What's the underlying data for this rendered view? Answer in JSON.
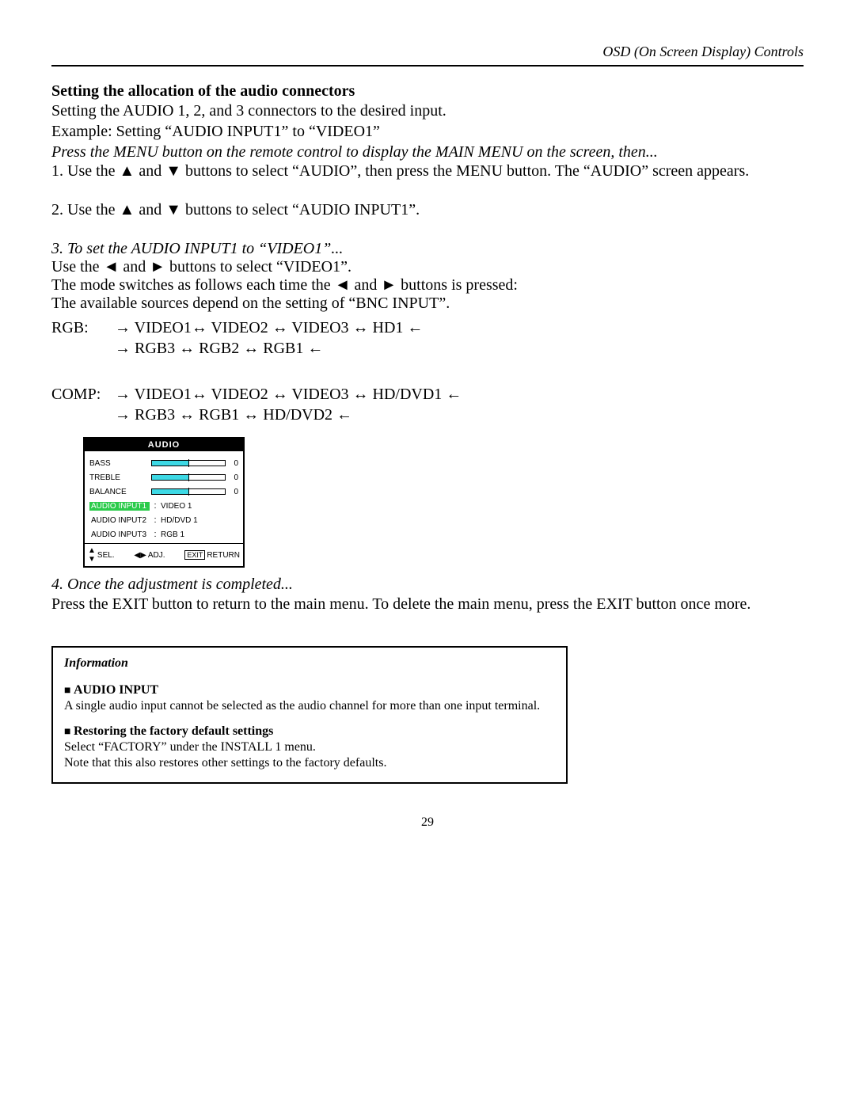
{
  "header": "OSD (On Screen Display) Controls",
  "title": "Setting the allocation of the audio connectors",
  "intro_line1": "Setting the AUDIO 1, 2, and 3 connectors to the desired input.",
  "intro_line2": "Example: Setting “AUDIO INPUT1” to “VIDEO1”",
  "intro_line3": "Press the MENU button on the remote control to display the MAIN MENU on the screen, then...",
  "step1_pre": "1. Use the ",
  "step1_mid": " buttons to select “AUDIO”, then press the MENU button. The “AUDIO” screen appears.",
  "step2_pre": "2. Use the ",
  "step2_mid": " buttons to select “AUDIO INPUT1”.",
  "step3_head": "3. To set the AUDIO INPUT1 to “VIDEO1”...",
  "step3_line1_pre": "Use the ",
  "step3_line1_post": " buttons to select “VIDEO1”.",
  "step3_line2_pre": "The mode switches as follows each time the  ",
  "step3_line2_post": " buttons is pressed:",
  "step3_line3": "The available sources depend on the setting of “BNC INPUT”.",
  "cycle_rgb_label": "RGB:",
  "cycle_rgb_line1": "→ VIDEO1↔ VIDEO2 ↔ VIDEO3 ↔ HD1 ←",
  "cycle_rgb_line2": "→ RGB3 ↔ RGB2 ↔ RGB1 ←",
  "cycle_comp_label": "COMP:",
  "cycle_comp_line1": "→ VIDEO1↔ VIDEO2 ↔ VIDEO3 ↔ HD/DVD1 ←",
  "cycle_comp_line2": "→ RGB3 ↔ RGB1 ↔ HD/DVD2 ←",
  "osd": {
    "title": "AUDIO",
    "rows": [
      {
        "label": "BASS",
        "value": "0"
      },
      {
        "label": "TREBLE",
        "value": "0"
      },
      {
        "label": "BALANCE",
        "value": "0"
      }
    ],
    "assigns": [
      {
        "label": "AUDIO INPUT1",
        "source": "VIDEO 1",
        "selected": true
      },
      {
        "label": "AUDIO INPUT2",
        "source": "HD/DVD 1",
        "selected": false
      },
      {
        "label": "AUDIO INPUT3",
        "source": "RGB 1",
        "selected": false
      }
    ],
    "footer_sel": "SEL.",
    "footer_adj": "ADJ.",
    "footer_exit": "EXIT",
    "footer_return": "RETURN"
  },
  "step4_head": "4. Once the adjustment is completed...",
  "step4_body": "Press the EXIT button to return to the main menu. To delete the main menu, press the EXIT button once more.",
  "info": {
    "heading": "Information",
    "item1_title": "AUDIO INPUT",
    "item1_body": "A single audio input cannot be selected as the audio channel for more than one input terminal.",
    "item2_title": "Restoring the factory default settings",
    "item2_body1": "Select “FACTORY” under the INSTALL 1 menu.",
    "item2_body2": "Note that this also restores other settings to the factory defaults."
  },
  "page_number": "29",
  "glyphs": {
    "up": "▲",
    "down": "▼",
    "left": "◄",
    "right": "►",
    "and": " and ",
    "square": "■ "
  }
}
